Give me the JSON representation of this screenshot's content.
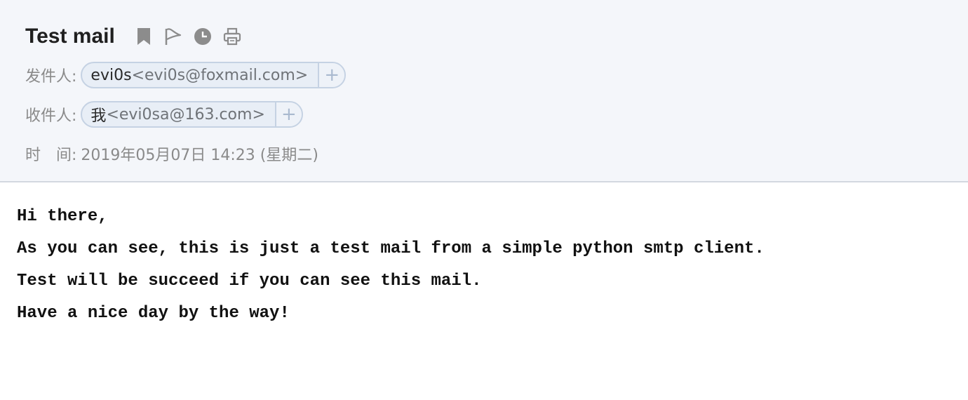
{
  "mail": {
    "subject": "Test mail",
    "toolbar": {
      "icons": [
        "bookmark-icon",
        "flag-icon",
        "clock-icon",
        "print-icon"
      ]
    },
    "from": {
      "label": "发件人:",
      "name": "evi0s",
      "address": "<evi0s@foxmail.com>",
      "add_label": "+"
    },
    "to": {
      "label": "收件人:",
      "name": "我",
      "address": "<evi0sa@163.com>",
      "add_label": "+"
    },
    "time": {
      "label": "时　间:",
      "value": "2019年05月07日 14:23 (星期二)"
    },
    "body": {
      "lines": [
        "Hi there,",
        "As you can see, this is just a test mail from a simple python smtp client.",
        "Test will be succeed if you can see this mail.",
        "Have a nice day by the way!"
      ]
    }
  },
  "colors": {
    "header_bg": "#f4f6fa",
    "icon_gray": "#8c8c8c",
    "chip_bg": "#e8eef6",
    "chip_border": "#c5d2e3"
  }
}
